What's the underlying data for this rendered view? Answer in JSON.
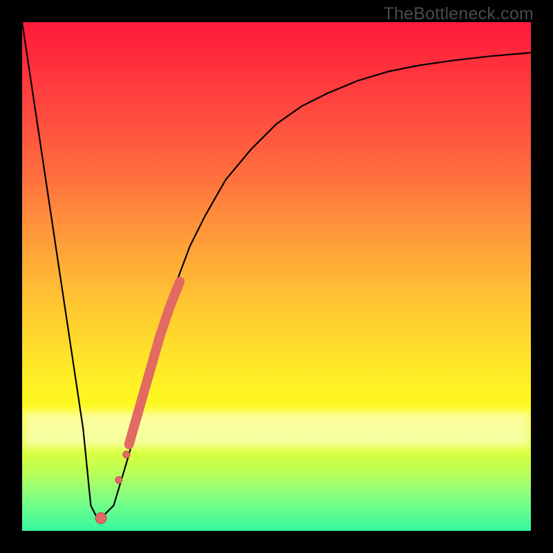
{
  "watermark": {
    "text": "TheBottleneck.com"
  },
  "colors": {
    "curve_stroke": "#000000",
    "marker_fill": "#e26a63",
    "marker_stroke": "#c14f49",
    "thick_stroke": "#e26a63"
  },
  "chart_data": {
    "type": "line",
    "title": "",
    "xlabel": "",
    "ylabel": "",
    "xlim": [
      0,
      100
    ],
    "ylim": [
      0,
      100
    ],
    "grid": false,
    "legend": false,
    "curve": {
      "x": [
        0,
        3,
        6,
        9,
        12,
        13.5,
        15,
        18,
        21,
        24,
        27,
        30,
        33,
        36,
        40,
        45,
        50,
        55,
        60,
        66,
        72,
        78,
        85,
        92,
        100
      ],
      "y": [
        100,
        80,
        60,
        40,
        20,
        5,
        2,
        5,
        15,
        27,
        38,
        48,
        56,
        62,
        69,
        75,
        80,
        83.5,
        86,
        88.5,
        90.3,
        91.5,
        92.5,
        93.3,
        94
      ]
    },
    "markers": [
      {
        "x": 15.5,
        "y": 2.5,
        "r": 8
      },
      {
        "x": 19.0,
        "y": 10.0,
        "r": 5
      },
      {
        "x": 20.5,
        "y": 15.0,
        "r": 5
      }
    ],
    "thick_segment": {
      "x": [
        21,
        23,
        25,
        27,
        29,
        31
      ],
      "y": [
        17,
        24,
        31,
        38,
        44,
        49
      ]
    }
  }
}
